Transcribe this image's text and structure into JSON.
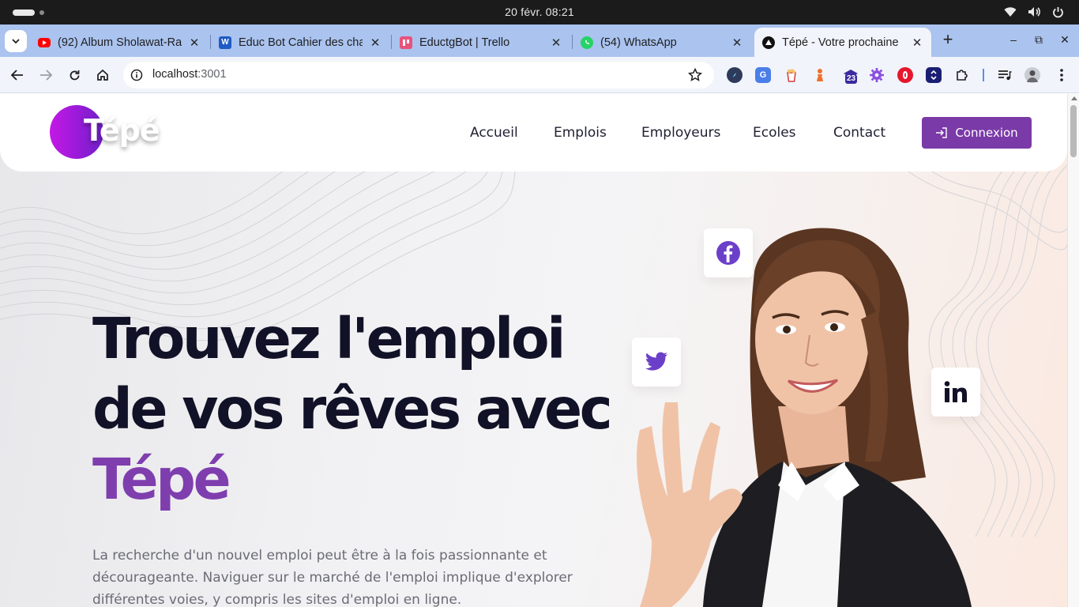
{
  "os": {
    "clock": "20 févr.  08:21",
    "tray_icons": [
      "wifi-icon",
      "volume-icon",
      "power-icon"
    ]
  },
  "browser": {
    "tabs": [
      {
        "title": "(92) Album Sholawat-Ra",
        "favicon": "youtube-icon",
        "close": "✕"
      },
      {
        "title": "Educ Bot Cahier des cha",
        "favicon": "word-icon",
        "close": "✕"
      },
      {
        "title": "EductgBot | Trello",
        "favicon": "trello-icon",
        "close": "✕"
      },
      {
        "title": "(54) WhatsApp",
        "favicon": "whatsapp-icon",
        "close": "✕"
      },
      {
        "title": "Tépé - Votre prochaine",
        "favicon": "app-triangle-icon",
        "close": "✕",
        "active": true
      }
    ],
    "new_tab": "+",
    "window_controls": {
      "minimize": "–",
      "restore": "⧉",
      "close": "✕"
    },
    "address": {
      "host": "localhost",
      "port": ":3001"
    },
    "extension_badge": "23"
  },
  "site": {
    "logo": "Tépé",
    "nav": [
      "Accueil",
      "Emplois",
      "Employeurs",
      "Ecoles",
      "Contact"
    ],
    "login_button": "Connexion",
    "hero": {
      "title_line1": "Trouvez l'emploi",
      "title_line2": "de vos rêves avec",
      "title_accent": "Tépé",
      "text": "La recherche d'un nouvel emploi peut être à la fois passionnante et décourageante. Naviguer sur le marché de l'emploi implique d'explorer différentes voies, y compris les sites d'emploi en ligne."
    },
    "social": [
      "facebook-icon",
      "twitter-icon",
      "linkedin-icon"
    ],
    "colors": {
      "brand": "#7f3eae",
      "button": "#7a3aa8",
      "title": "#111127",
      "logo_gradient_start": "#c419e5"
    }
  }
}
